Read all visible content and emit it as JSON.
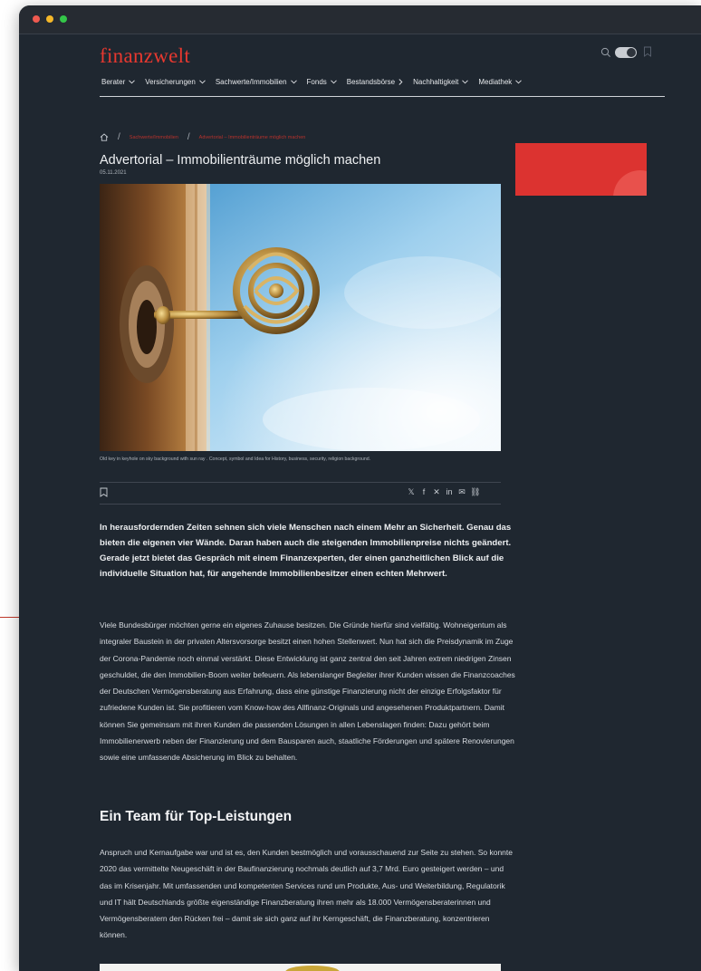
{
  "brand": {
    "logo": "finanzwelt",
    "accent_color": "#e8382f"
  },
  "nav": {
    "items": [
      {
        "label": "Berater",
        "icon": "chevron-down-icon"
      },
      {
        "label": "Versicherungen",
        "icon": "chevron-down-icon"
      },
      {
        "label": "Sachwerte/Immobilien",
        "icon": "chevron-down-icon"
      },
      {
        "label": "Fonds",
        "icon": "chevron-down-icon"
      },
      {
        "label": "Bestandsbörse",
        "icon": "chevron-right-icon"
      },
      {
        "label": "Nachhaltigkeit",
        "icon": "chevron-down-icon"
      },
      {
        "label": "Mediathek",
        "icon": "chevron-down-icon"
      }
    ]
  },
  "breadcrumb": {
    "items": [
      "Sachwerte/Immobilien",
      "Advertorial – Immobilienträume möglich machen"
    ]
  },
  "article": {
    "title": "Advertorial – Immobilienträume möglich machen",
    "date": "05.11.2021",
    "image_caption": "Old key in keyhole on sky background with sun ray . Concept, symbol and Idea for History, business, security, religion background.",
    "lead": "In herausfordernden Zeiten sehnen sich viele Menschen nach einem Mehr an Sicherheit. Genau das bieten die eigenen vier Wände. Daran haben auch die steigenden Immobilienpreise nichts geändert. Gerade jetzt bietet das Gespräch mit einem Finanzexperten, der einen ganzheitlichen Blick auf die individuelle Situation hat, für angehende Immobilienbesitzer einen echten Mehrwert.",
    "paragraph1": "Viele Bundesbürger möchten gerne ein eigenes Zuhause besitzen. Die Gründe hierfür sind vielfältig. Wohneigentum als integraler Baustein in der privaten Altersvorsorge besitzt einen hohen Stellenwert. Nun hat sich die Preisdynamik im Zuge der Corona-Pandemie noch einmal verstärkt. Diese Entwicklung ist ganz zentral den seit Jahren extrem niedrigen Zinsen geschuldet, die den Immobilien-Boom weiter befeuern. Als lebenslanger Begleiter ihrer Kunden wissen die Finanzcoaches der Deutschen Vermögensberatung aus Erfahrung, dass eine günstige Finanzierung nicht der einzige Erfolgsfaktor für zufriedene Kunden ist. Sie profitieren vom Know-how des Allfinanz-Originals und angesehenen Produktpartnern. Damit können Sie gemeinsam mit ihren Kunden die passenden Lösungen in allen Lebenslagen finden: Dazu gehört beim Immobilienerwerb neben der Finanzierung und dem Bausparen auch, staatliche Förderungen und spätere Renovierungen sowie eine umfassende Absicherung im Blick zu behalten.",
    "heading2": "Ein Team für Top-Leistungen",
    "paragraph2": "Anspruch und Kernaufgabe war und ist es, den Kunden bestmöglich und vorausschauend zur Seite zu stehen. So konnte 2020 das vermittelte Neugeschäft in der Baufinanzierung nochmals deutlich auf 3,7 Mrd. Euro gesteigert werden – und das im Krisenjahr. Mit umfassenden und kompetenten Services rund um Produkte, Aus- und Weiterbildung, Regulatorik und IT hält Deutschlands größte eigenständige Finanzberatung ihren mehr als 18.000 Vermögensberaterinnen und Vermögensberatern den Rücken frei – damit sie sich ganz auf ihr Kerngeschäft, die Finanzberatung, konzentrieren können."
  },
  "share": {
    "icons": [
      "x-icon",
      "facebook-icon",
      "xing-icon",
      "linkedin-icon",
      "mail-icon",
      "link-icon"
    ]
  },
  "colors": {
    "window_bg": "#1f2730",
    "ad_red": "#dc3330",
    "annotation": "#d0433a"
  }
}
